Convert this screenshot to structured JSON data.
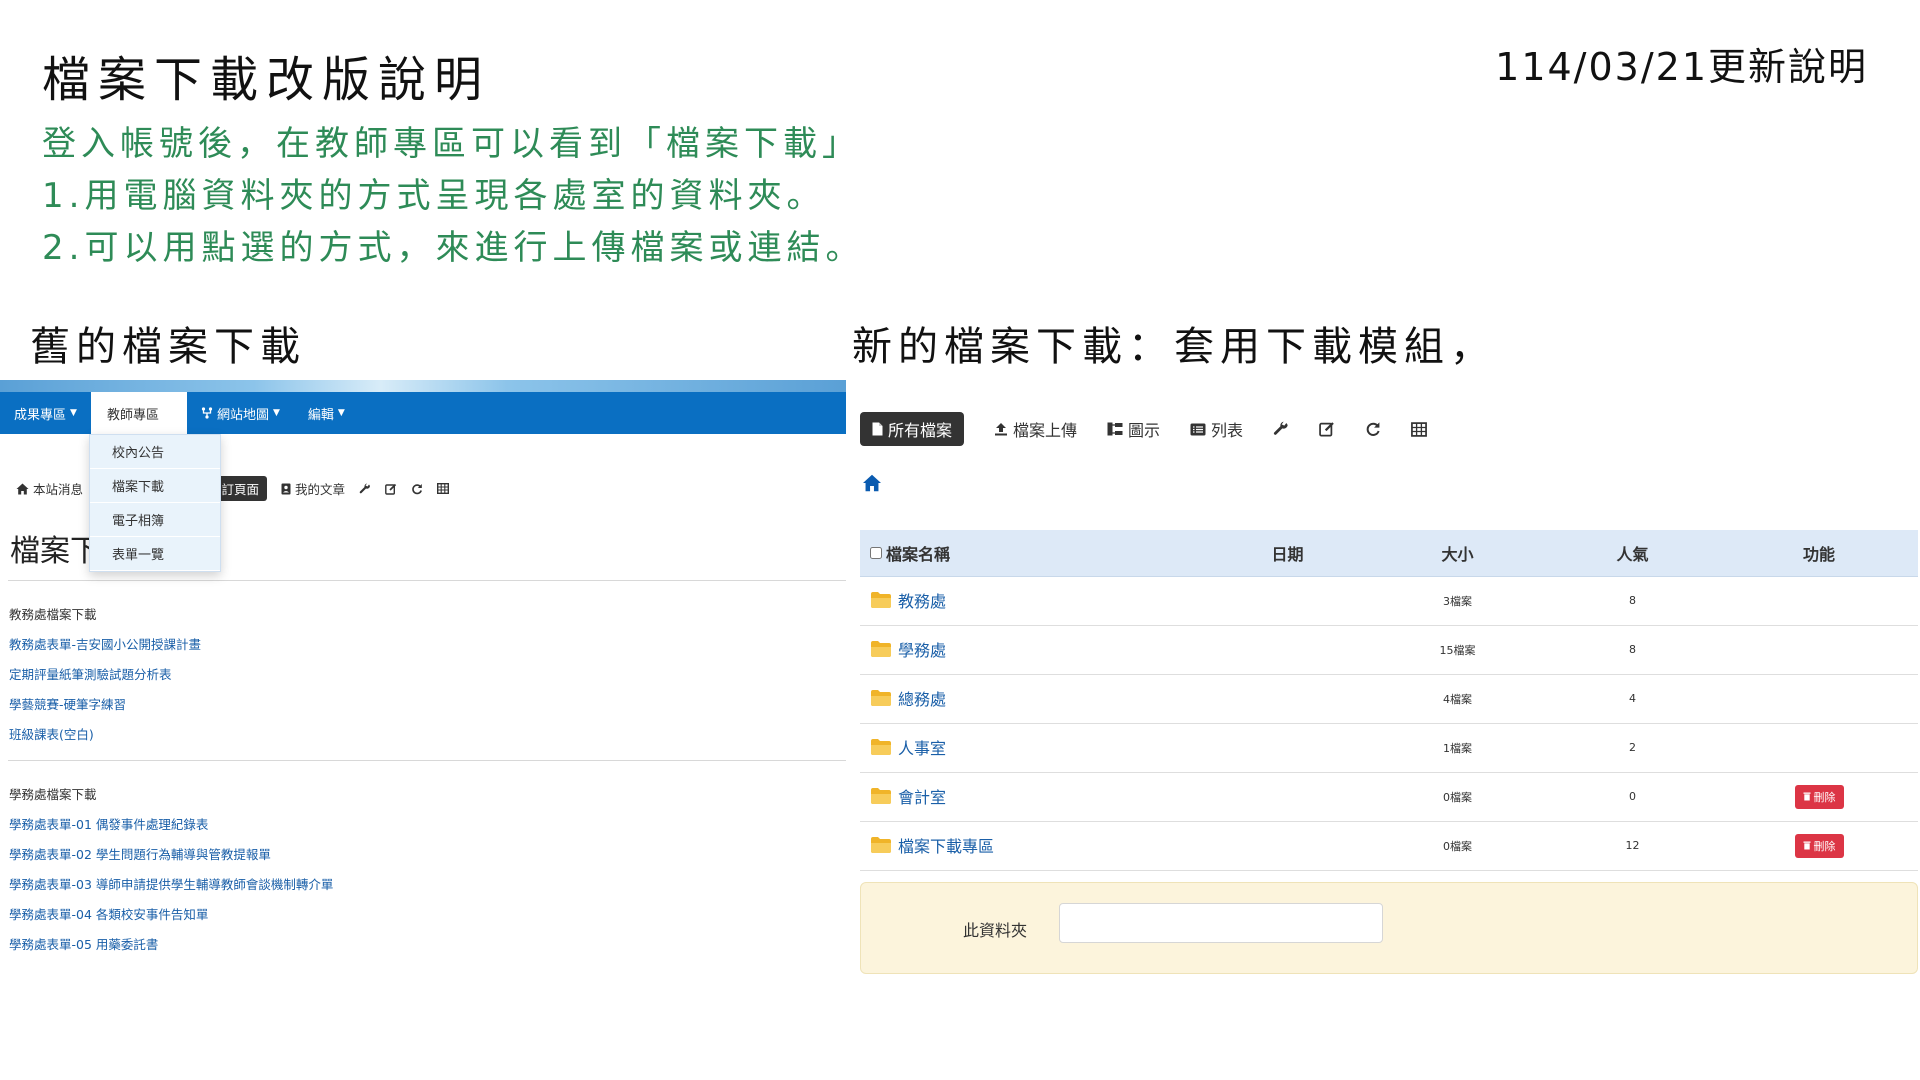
{
  "slide": {
    "title": "檔案下載改版說明",
    "update_note": "114/03/21更新說明",
    "intro_lines": [
      "登入帳號後，在教師專區可以看到「檔案下載」",
      "1.用電腦資料夾的方式呈現各處室的資料夾。",
      "2.可以用點選的方式，來進行上傳檔案或連結。"
    ],
    "old_section_title": "舊的檔案下載",
    "new_section_title": "新的檔案下載：套用下載模組，"
  },
  "old_ui": {
    "nav": [
      "成果專區",
      "教師專區",
      "網站地圖",
      "編輯"
    ],
    "dropdown": [
      "校內公告",
      "檔案下載",
      "電子相簿",
      "表單一覽"
    ],
    "toolbar": {
      "news": "本站消息",
      "custom_page": "自訂頁面",
      "my_articles": "我的文章"
    },
    "heading": "檔案下載",
    "sections": [
      {
        "label": "教務處檔案下載",
        "links": [
          "教務處表單-吉安國小公開授課計畫",
          "定期評量紙筆測驗試題分析表",
          "學藝競賽-硬筆字練習",
          "班級課表(空白)"
        ]
      },
      {
        "label": "學務處檔案下載",
        "links": [
          "學務處表單-01 偶發事件處理紀錄表",
          "學務處表單-02 學生問題行為輔導與管教提報單",
          "學務處表單-03 導師申請提供學生輔導教師會談機制轉介單",
          "學務處表單-04 各類校安事件告知單",
          "學務處表單-05 用藥委託書"
        ]
      }
    ]
  },
  "new_ui": {
    "toolbar": {
      "all_files": "所有檔案",
      "upload": "檔案上傳",
      "diagram": "圖示",
      "list": "列表"
    },
    "table": {
      "headers": {
        "name": "檔案名稱",
        "date": "日期",
        "size": "大小",
        "popularity": "人氣",
        "actions": "功能"
      },
      "rows": [
        {
          "name": "教務處",
          "size": "3檔案",
          "popularity": "8",
          "delete": ""
        },
        {
          "name": "學務處",
          "size": "15檔案",
          "popularity": "8",
          "delete": ""
        },
        {
          "name": "總務處",
          "size": "4檔案",
          "popularity": "4",
          "delete": ""
        },
        {
          "name": "人事室",
          "size": "1檔案",
          "popularity": "2",
          "delete": ""
        },
        {
          "name": "會計室",
          "size": "0檔案",
          "popularity": "0",
          "delete": "刪除"
        },
        {
          "name": "檔案下載專區",
          "size": "0檔案",
          "popularity": "12",
          "delete": "刪除"
        }
      ]
    },
    "this_folder_label": "此資料夾",
    "colors": {
      "delete": "#dc3545",
      "folder": "#f0b429",
      "header_bg": "#dde9f7",
      "panel_bg": "#fcf4dc"
    }
  }
}
